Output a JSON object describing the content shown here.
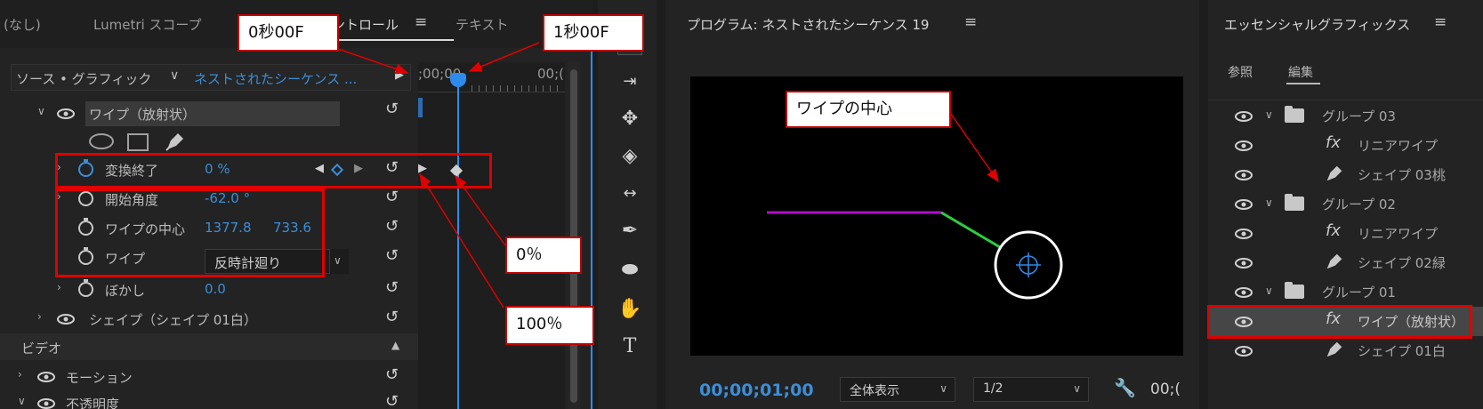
{
  "effect_controls": {
    "tabs": [
      {
        "label": "(なし)"
      },
      {
        "label": "Lumetri スコープ"
      },
      {
        "label": "コントロール"
      },
      {
        "label": "テキスト"
      }
    ],
    "source_label": "ソース • グラフィック",
    "sequence_label": "ネストされたシーケンス ...",
    "time_start": ";00;00",
    "time_end": "00;(",
    "effect_name": "ワイプ（放射状）",
    "params": {
      "transition_end": {
        "label": "変換終了",
        "value": "0 %"
      },
      "start_angle": {
        "label": "開始角度",
        "value": "-62.0 °"
      },
      "wipe_center": {
        "label": "ワイプの中心",
        "x": "1377.8",
        "y": "733.6"
      },
      "wipe": {
        "label": "ワイプ",
        "value": "反時計廻り"
      },
      "feather": {
        "label": "ぼかし",
        "value": "0.0"
      }
    },
    "shape_layer": "シェイプ（シェイプ 01白）",
    "video_section": "ビデオ",
    "motion": "モーション",
    "opacity": "不透明度"
  },
  "program_monitor": {
    "title": "プログラム: ネストされたシーケンス 19",
    "timecode": "00;00;01;00",
    "zoom": "全体表示",
    "resolution": "1/2",
    "timecode_right": "00;("
  },
  "essential_graphics": {
    "title": "エッセンシャルグラフィックス",
    "tabs": [
      {
        "label": "参照"
      },
      {
        "label": "編集"
      }
    ],
    "layers": [
      {
        "label": "グループ 03"
      },
      {
        "label": "リニアワイプ"
      },
      {
        "label": "シェイプ 03桃"
      },
      {
        "label": "グループ 02"
      },
      {
        "label": "リニアワイプ"
      },
      {
        "label": "シェイプ 02緑"
      },
      {
        "label": "グループ 01"
      },
      {
        "label": "ワイプ（放射状）"
      },
      {
        "label": "シェイプ 01白"
      }
    ]
  },
  "annotations": {
    "zero_sec": "0秒00F",
    "one_sec": "1秒00F",
    "zero_pct": "0％",
    "hundred_pct": "100％",
    "wipe_center": "ワイプの中心"
  },
  "colors": {
    "accent": "#2d8ceb",
    "value_blue": "#3b8ed8",
    "annotation_red": "#e00000",
    "magenta_line": "#b10dc9",
    "green_line": "#2ecc40"
  }
}
